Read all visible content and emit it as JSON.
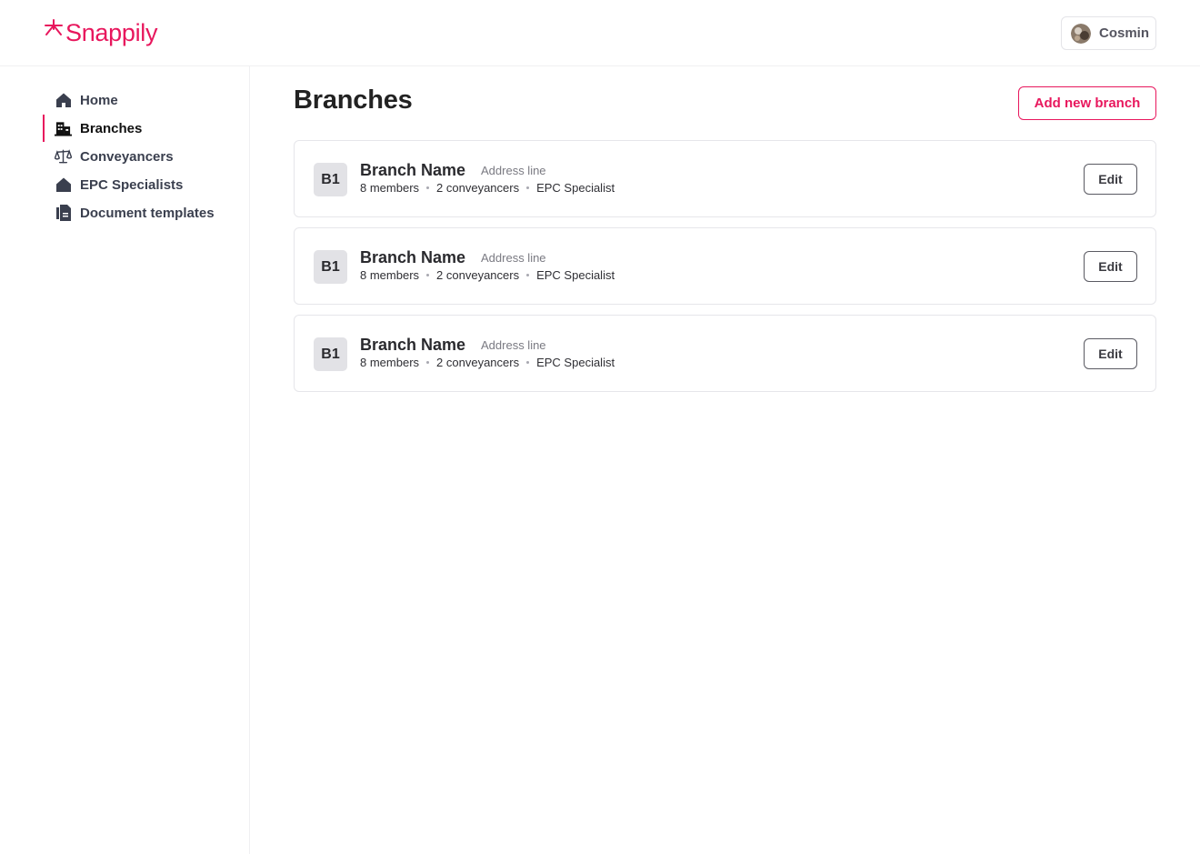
{
  "app": {
    "brand": "Snappily",
    "brand_color": "#e8175d"
  },
  "header": {
    "user_name": "Cosmin"
  },
  "sidebar": {
    "items": [
      {
        "label": "Home",
        "icon": "house-icon",
        "active": false
      },
      {
        "label": "Branches",
        "icon": "building-icon",
        "active": true
      },
      {
        "label": "Conveyancers",
        "icon": "scales-icon",
        "active": false
      },
      {
        "label": "EPC Specialists",
        "icon": "house-icon",
        "active": false
      },
      {
        "label": "Document templates",
        "icon": "document-icon",
        "active": false
      }
    ]
  },
  "main": {
    "title": "Branches",
    "add_button": "Add new branch",
    "branches": [
      {
        "badge": "B1",
        "name": "Branch Name",
        "address": "Address line",
        "members": "8 members",
        "conveyancers": "2 conveyancers",
        "specialist": "EPC Specialist",
        "edit": "Edit"
      },
      {
        "badge": "B1",
        "name": "Branch Name",
        "address": "Address line",
        "members": "8 members",
        "conveyancers": "2 conveyancers",
        "specialist": "EPC Specialist",
        "edit": "Edit"
      },
      {
        "badge": "B1",
        "name": "Branch Name",
        "address": "Address line",
        "members": "8 members",
        "conveyancers": "2 conveyancers",
        "specialist": "EPC Specialist",
        "edit": "Edit"
      }
    ]
  }
}
